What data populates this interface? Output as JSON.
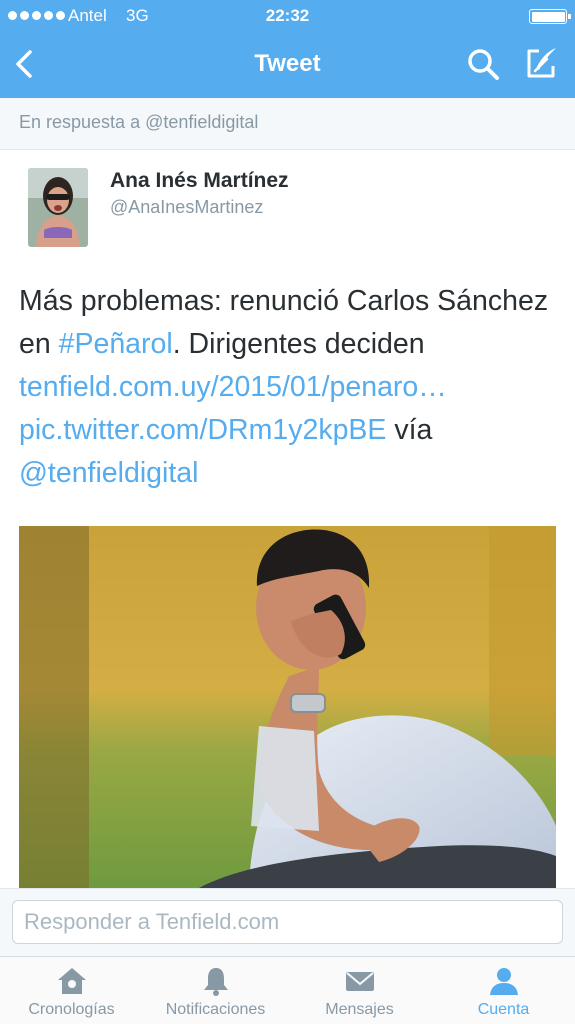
{
  "status_bar": {
    "carrier": "Antel",
    "network": "3G",
    "time": "22:32"
  },
  "nav": {
    "title": "Tweet",
    "back_icon": "chevron-left-icon",
    "search_icon": "search-icon",
    "compose_icon": "compose-icon"
  },
  "reply_context": {
    "text": "En respuesta a @tenfieldigital"
  },
  "tweet": {
    "display_name": "Ana Inés Martínez",
    "handle": "@AnaInesMartinez",
    "text_1": "Más problemas: renunció Carlos Sánchez en ",
    "hashtag": "#Peñarol",
    "text_2": ". Dirigentes deciden ",
    "link_1": "tenfield.com.uy/2015/01/penaro…",
    "link_2": "pic.twitter.com/DRm1y2kpBE",
    "text_3": " vía ",
    "mention": "@tenfieldigital"
  },
  "reply_bar": {
    "placeholder": "Responder a Tenfield.com"
  },
  "tabs": [
    {
      "label": "Cronologías",
      "icon": "home-icon"
    },
    {
      "label": "Notificaciones",
      "icon": "bell-icon"
    },
    {
      "label": "Mensajes",
      "icon": "envelope-icon"
    },
    {
      "label": "Cuenta",
      "icon": "person-icon",
      "active": true
    }
  ],
  "colors": {
    "accent": "#55acee",
    "text": "#292f33",
    "muted": "#8899a6"
  }
}
